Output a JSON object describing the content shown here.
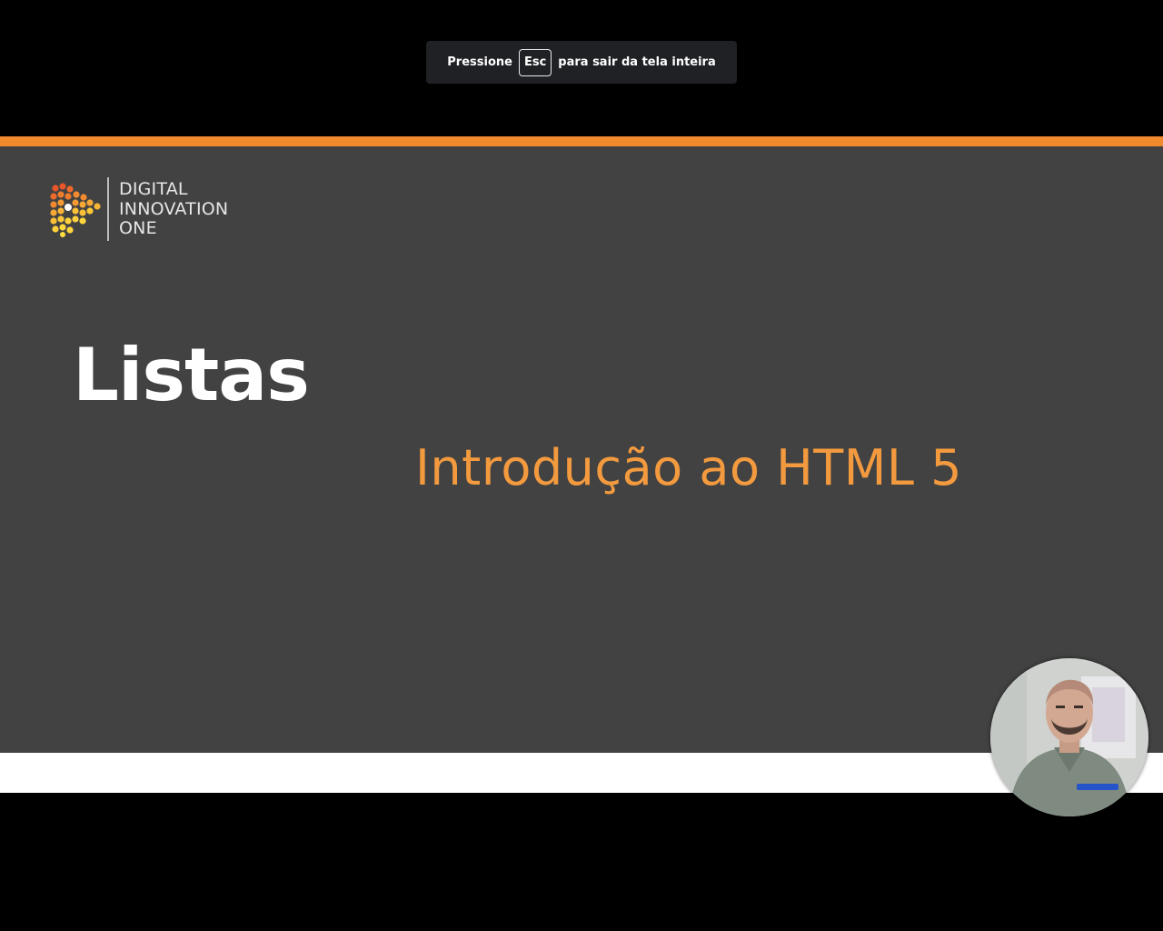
{
  "fullscreen_toast": {
    "prefix": "Pressione",
    "key": "Esc",
    "suffix": "para sair da tela inteira"
  },
  "slide": {
    "logo_lines": [
      "DIGITAL",
      "INNOVATION",
      "ONE"
    ],
    "title": "Listas",
    "subtitle": "Introdução ao HTML 5"
  },
  "colors": {
    "accent_orange": "#f08a2c",
    "slide_background": "#424242",
    "subtitle_orange": "#f39a3f"
  },
  "webcam": {
    "icon": "presenter-webcam"
  }
}
